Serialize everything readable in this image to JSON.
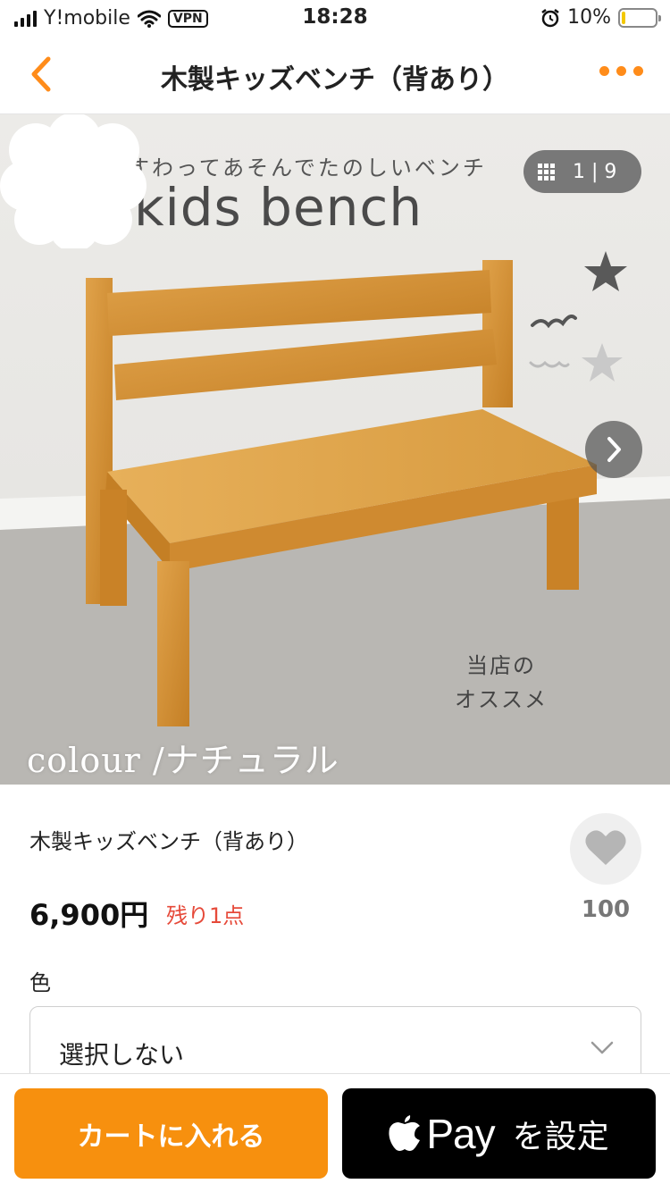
{
  "status_bar": {
    "carrier": "Y!mobile",
    "vpn": "VPN",
    "time": "18:28",
    "battery": "10%"
  },
  "nav": {
    "title": "木製キッズベンチ（背あり）",
    "accent_color": "#ff8c1a"
  },
  "gallery": {
    "subtitle": "すわってあそんでたのしいベンチ",
    "title": "kids bench",
    "counter": "1 | 9",
    "badge_line1": "当店の",
    "badge_line2": "オススメ",
    "colour_caption": "colour /ナチュラル"
  },
  "product": {
    "name": "木製キッズベンチ（背あり）",
    "price": "6,900円",
    "stock": "残り1点",
    "like_count": "100"
  },
  "options": {
    "color_label": "色",
    "color_value": "選択しない"
  },
  "actions": {
    "cart_label": "カートに入れる",
    "applepay_pay": "Pay",
    "applepay_setup": "を設定",
    "cart_color": "#f7900e"
  }
}
